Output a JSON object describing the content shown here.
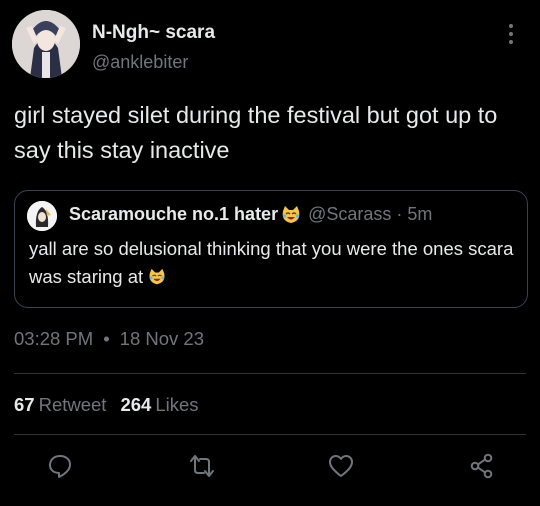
{
  "author": {
    "name": "N-Ngh~ scara",
    "handle": "@anklebiter"
  },
  "tweet": {
    "text": "girl stayed silet during the festival but got up to say this stay inactive"
  },
  "quote": {
    "name": "Scaramouche no.1 hater",
    "name_emoji": "laughing-cat-emoji",
    "handle": "@Scarass",
    "dot": "·",
    "time": "5m",
    "text": "yall are so delusional thinking that you were the ones scara was staring at",
    "text_emoji": "laughing-cat-emoji"
  },
  "meta": {
    "time": "03:28 PM",
    "separator": "•",
    "date": "18 Nov 23"
  },
  "stats": {
    "retweets": "67",
    "retweets_label": "Retweet",
    "likes": "264",
    "likes_label": "Likes"
  },
  "actions": [
    {
      "icon": "reply-icon"
    },
    {
      "icon": "retweet-icon"
    },
    {
      "icon": "like-icon"
    },
    {
      "icon": "share-icon"
    }
  ],
  "colors": {
    "background": "#000000",
    "text": "#e7e9ea",
    "muted": "#71767b",
    "border": "#38444d"
  }
}
